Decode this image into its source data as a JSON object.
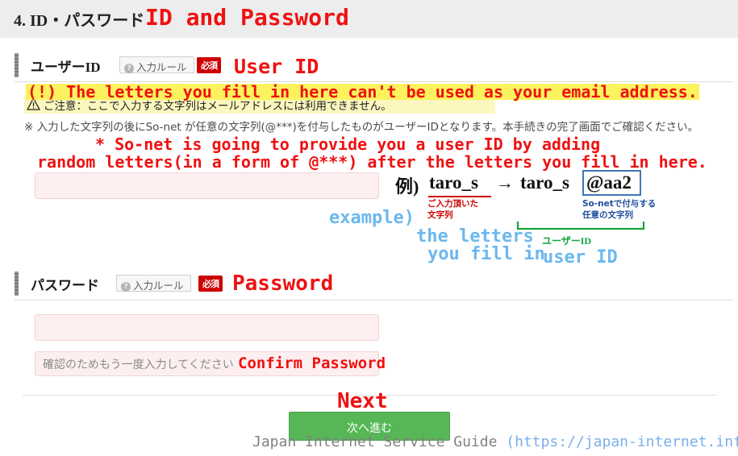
{
  "header": {
    "jp_title": "4. ID・パスワード",
    "annotation": "ID and Password"
  },
  "user_id_section": {
    "label_jp": "ユーザーID",
    "rule_button": "入力ルール",
    "rule_icon": "question-mark-icon",
    "required_badge": "必須",
    "annotation": "User ID",
    "caution": {
      "icon": "warning-triangle-icon",
      "text_jp": "ご注意：ここで入力する文字列はメールアドレスには利用できません。",
      "annotation": "(!) The letters you fill in here can't be used as your email address."
    },
    "note_jp": "※ 入力した文字列の後にSo-net が任意の文字列(@***)を付与したものがユーザーIDとなります。本手続きの完了画面でご確認ください。",
    "note_annotation_line1": "* So-net is going to provide you a user ID by adding",
    "note_annotation_line2": "random letters(in a form of @***) after the letters you fill in here.",
    "input_value": "",
    "input_placeholder": ""
  },
  "example": {
    "prefix_jp": "例)",
    "base": "taro_s",
    "arrow": "→",
    "result_base": "taro_s",
    "result_suffix": "@aa2",
    "caption_red_line1": "ご入力頂いた",
    "caption_red_line2": "文字列",
    "caption_blue_line1": "So-netで付与する",
    "caption_blue_line2": "任意の文字列",
    "caption_green": "ユーザーID",
    "annotation_example": "example)",
    "annotation_letters_line1": "the letters",
    "annotation_letters_line2": "you fill in",
    "annotation_userid": "user ID"
  },
  "password_section": {
    "label_jp": "パスワード",
    "rule_button": "入力ルール",
    "rule_icon": "question-mark-icon",
    "required_badge": "必須",
    "annotation": "Password",
    "password_value": "",
    "password_placeholder": "",
    "confirm_placeholder_jp": "確認のためもう一度入力してください",
    "confirm_annotation": "Confirm Password",
    "confirm_value": ""
  },
  "submit": {
    "button_label": "次へ進む",
    "annotation": "Next"
  },
  "footer": {
    "text": "Japan Internet Service Guide ",
    "url": "(https://japan-internet.info/en/)"
  },
  "colors": {
    "annotation_red": "#ee1111",
    "annotation_blue": "#6cb8ee",
    "annotation_green": "#21b14c",
    "required_red": "#cc0000",
    "button_green": "#57b757",
    "caution_highlight": "#fbf7bf",
    "header_gray": "#ededed",
    "input_pink": "#fdeff0"
  }
}
